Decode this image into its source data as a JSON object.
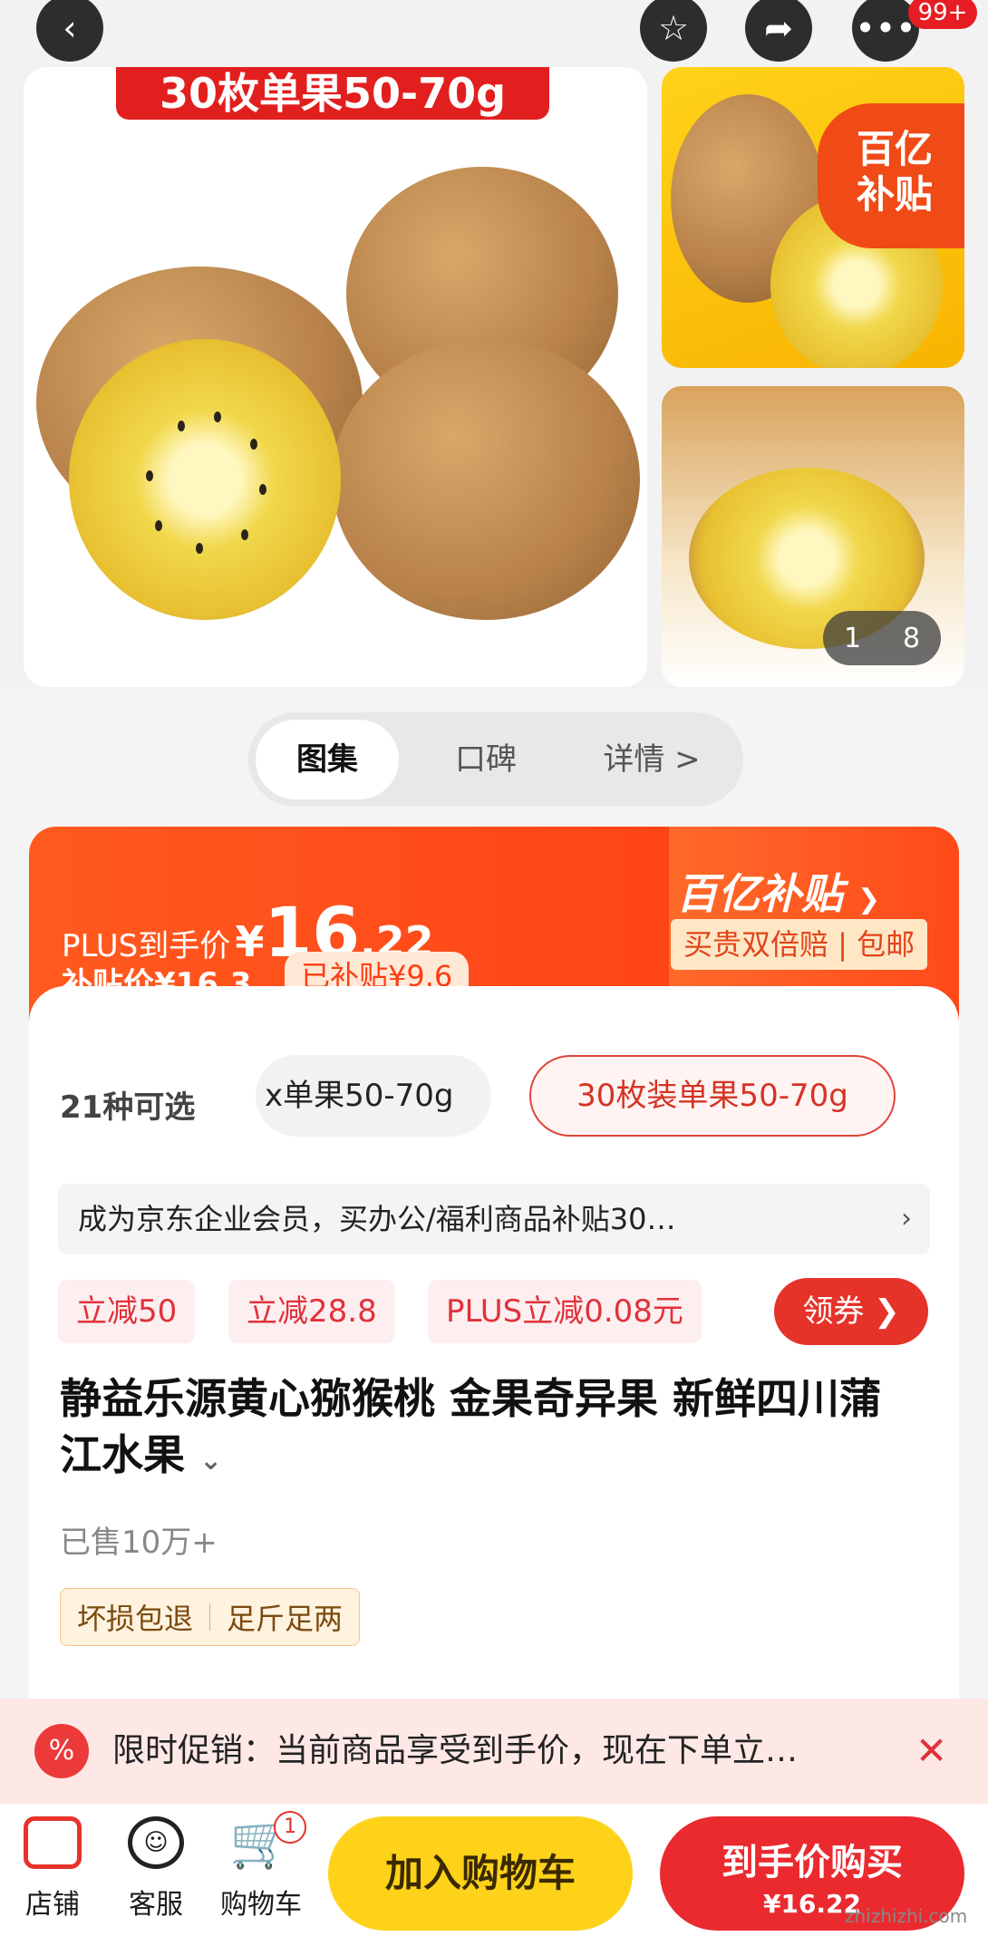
{
  "gallery": {
    "main_image_banner": "30枚单果50-70g",
    "thumb_badge_line1": "百亿",
    "thumb_badge_line2": "补贴",
    "counter_current": "1",
    "counter_total": "8",
    "cart_count": "99+"
  },
  "tabs": [
    "图集",
    "口碑",
    "详情 >"
  ],
  "price": {
    "plus_label": "PLUS到手价",
    "currency": "¥",
    "plus_int": "16",
    "plus_dec": ".22",
    "subsidy_label": "补贴价",
    "subsidy_value": "¥16.3",
    "subsidized": "已补贴¥9.6",
    "brand_badge": "百亿补贴",
    "guarantee": "买贵双倍赔 | 包邮"
  },
  "variants": {
    "count": "21种可选",
    "option_a": "x单果50-70g",
    "option_b": "30枚装单果50-70g"
  },
  "enterprise_notice": "成为京东企业会员，买办公/福利商品补贴30…",
  "coupons": [
    "立减50",
    "立减28.8",
    "PLUS立减0.08元"
  ],
  "coupon_button": "领券",
  "product": {
    "title": "静益乐源黄心猕猴桃 金果奇异果 新鲜四川蒲江水果",
    "sold": "已售10万+",
    "tags": [
      "坏损包退",
      "足斤足两"
    ]
  },
  "promo": {
    "text": "限时促销：当前商品享受到手价，现在下单立…"
  },
  "footer": {
    "shop": "店铺",
    "service": "客服",
    "cart": "购物车",
    "cart_badge": "1",
    "add_to_cart": "加入购物车",
    "buy_label": "到手价购买",
    "buy_price": "¥16.22"
  },
  "watermark": "zhizhizhi.com",
  "colors": {
    "accent": "#ff3c14",
    "yellow": "#ffd21a",
    "red": "#e61e24"
  }
}
